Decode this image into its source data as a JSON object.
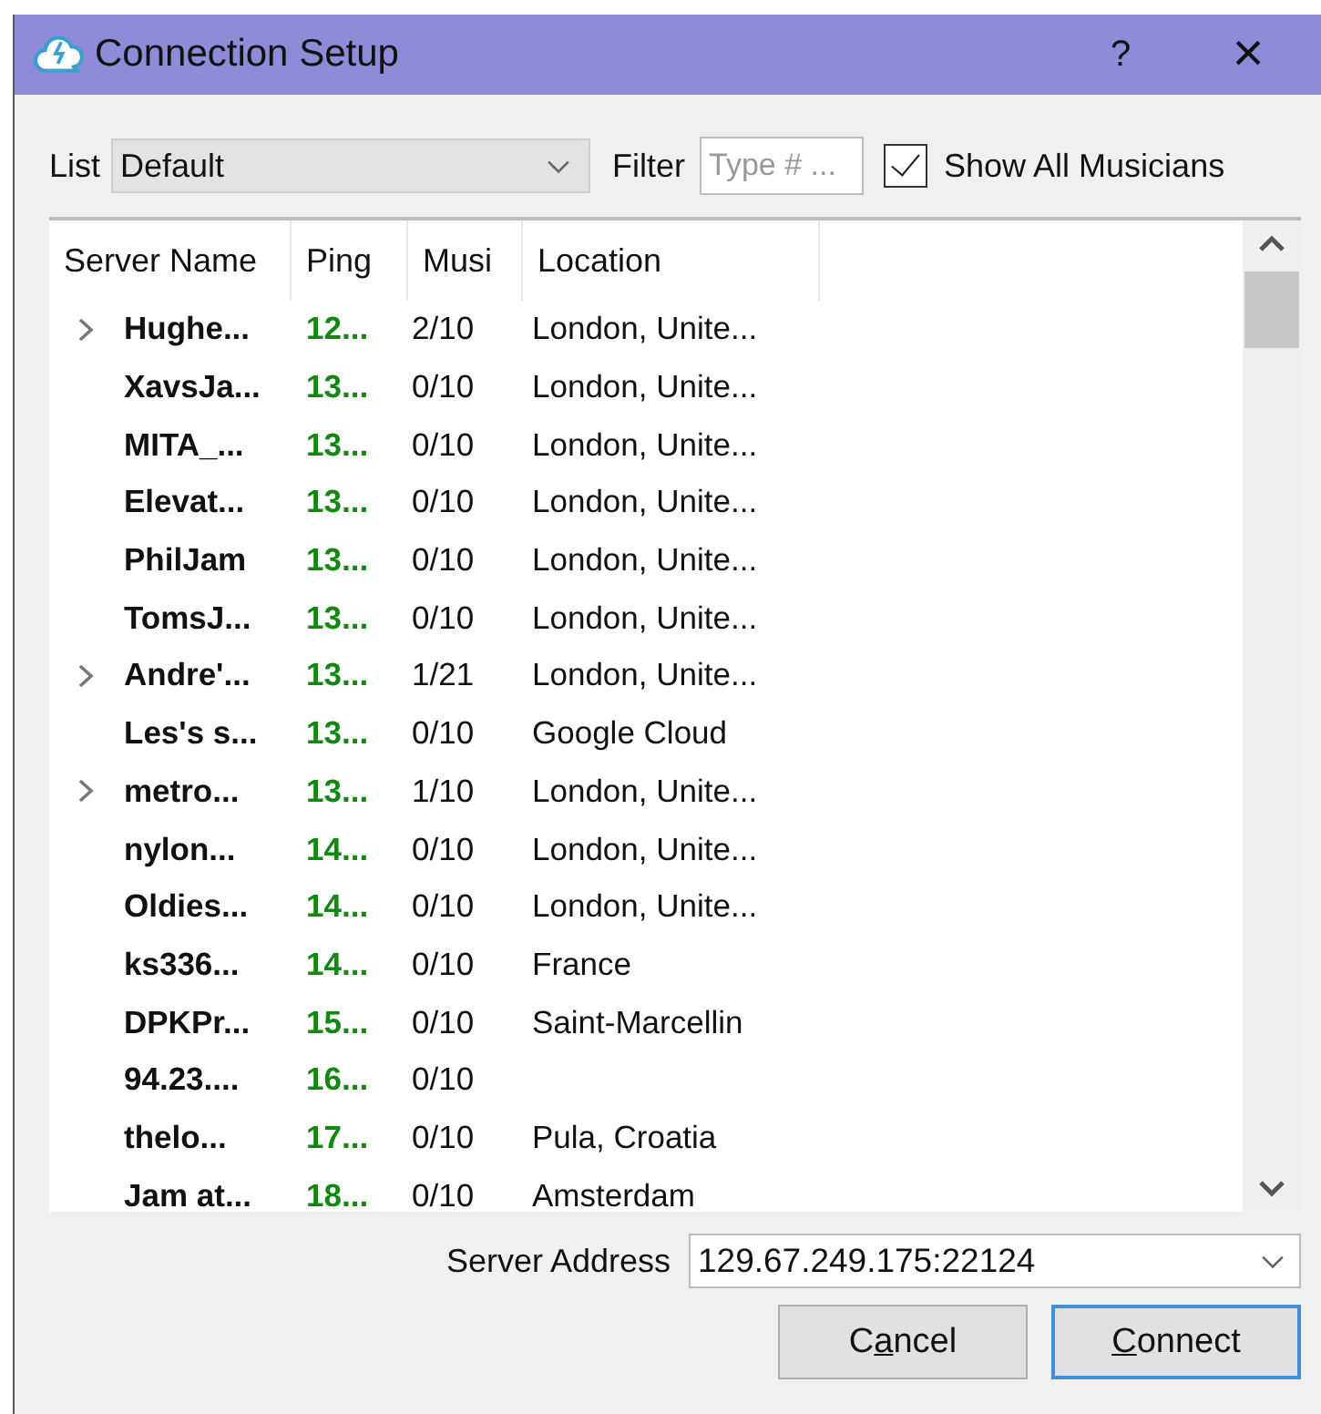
{
  "window": {
    "title": "Connection Setup",
    "help": "?",
    "close": "×"
  },
  "toolbar": {
    "list_label": "List",
    "list_value": "Default",
    "filter_label": "Filter",
    "filter_placeholder": "Type # ...",
    "show_all": {
      "label": "Show All Musicians",
      "checked": true
    }
  },
  "table": {
    "columns": [
      "Server Name",
      "Ping",
      "Musi",
      "Location"
    ],
    "rows": [
      {
        "name": "Hughe...",
        "ping": "12...",
        "musicians": "2/10",
        "location": "London, Unite...",
        "expandable": true
      },
      {
        "name": "XavsJa...",
        "ping": "13...",
        "musicians": "0/10",
        "location": "London, Unite...",
        "expandable": false
      },
      {
        "name": "MITA_...",
        "ping": "13...",
        "musicians": "0/10",
        "location": "London, Unite...",
        "expandable": false
      },
      {
        "name": "Elevat...",
        "ping": "13...",
        "musicians": "0/10",
        "location": "London, Unite...",
        "expandable": false
      },
      {
        "name": "PhilJam",
        "ping": "13...",
        "musicians": "0/10",
        "location": "London, Unite...",
        "expandable": false
      },
      {
        "name": "TomsJ...",
        "ping": "13...",
        "musicians": "0/10",
        "location": "London, Unite...",
        "expandable": false
      },
      {
        "name": "Andre'...",
        "ping": "13...",
        "musicians": "1/21",
        "location": "London, Unite...",
        "expandable": true
      },
      {
        "name": "Les's s...",
        "ping": "13...",
        "musicians": "0/10",
        "location": "Google Cloud",
        "expandable": false
      },
      {
        "name": "metro...",
        "ping": "13...",
        "musicians": "1/10",
        "location": "London, Unite...",
        "expandable": true
      },
      {
        "name": "nylon...",
        "ping": "14...",
        "musicians": "0/10",
        "location": "London, Unite...",
        "expandable": false
      },
      {
        "name": "Oldies...",
        "ping": "14...",
        "musicians": "0/10",
        "location": "London, Unite...",
        "expandable": false
      },
      {
        "name": "ks336...",
        "ping": "14...",
        "musicians": "0/10",
        "location": "France",
        "expandable": false
      },
      {
        "name": "DPKPr...",
        "ping": "15...",
        "musicians": "0/10",
        "location": "Saint-Marcellin",
        "expandable": false
      },
      {
        "name": "94.23....",
        "ping": "16...",
        "musicians": "0/10",
        "expandable": false
      },
      {
        "name": "thelo...",
        "ping": "17...",
        "musicians": "0/10",
        "location": "Pula, Croatia",
        "expandable": false
      },
      {
        "name": "Jam at...",
        "ping": "18...",
        "musicians": "0/10",
        "location": "Amsterdam",
        "expandable": false
      }
    ]
  },
  "server_address": {
    "label": "Server Address",
    "value": "129.67.249.175:22124"
  },
  "buttons": [
    {
      "before": "C",
      "key": "a",
      "after": "ncel",
      "default": false
    },
    {
      "key": "C",
      "after": "onnect",
      "default": true
    }
  ]
}
